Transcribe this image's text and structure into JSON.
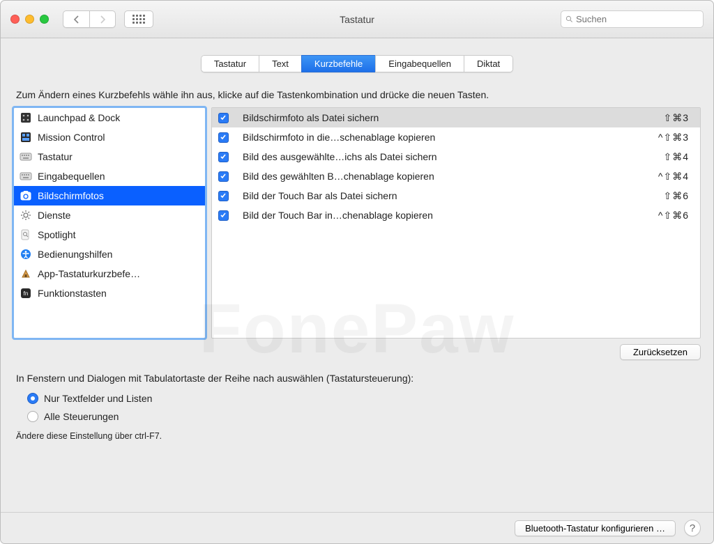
{
  "window": {
    "title": "Tastatur"
  },
  "search": {
    "placeholder": "Suchen"
  },
  "tabs": [
    {
      "label": "Tastatur",
      "active": false
    },
    {
      "label": "Text",
      "active": false
    },
    {
      "label": "Kurzbefehle",
      "active": true
    },
    {
      "label": "Eingabequellen",
      "active": false
    },
    {
      "label": "Diktat",
      "active": false
    }
  ],
  "instruction": "Zum Ändern eines Kurzbefehls wähle ihn aus, klicke auf die Tastenkombination und drücke die neuen Tasten.",
  "categories": [
    {
      "label": "Launchpad & Dock",
      "icon": "launchpad"
    },
    {
      "label": "Mission Control",
      "icon": "mission"
    },
    {
      "label": "Tastatur",
      "icon": "keyboard"
    },
    {
      "label": "Eingabequellen",
      "icon": "keyboard"
    },
    {
      "label": "Bildschirmfotos",
      "icon": "screenshot",
      "selected": true
    },
    {
      "label": "Dienste",
      "icon": "gear"
    },
    {
      "label": "Spotlight",
      "icon": "spotlight"
    },
    {
      "label": "Bedienungshilfen",
      "icon": "accessibility"
    },
    {
      "label": "App-Tastaturkurzbefe…",
      "icon": "app"
    },
    {
      "label": "Funktionstasten",
      "icon": "fn"
    }
  ],
  "shortcuts": [
    {
      "label": "Bildschirmfoto als Datei sichern",
      "keys": "⇧⌘3",
      "checked": true,
      "selected": true
    },
    {
      "label": "Bildschirmfoto in die…schenablage kopieren",
      "keys": "^⇧⌘3",
      "checked": true
    },
    {
      "label": "Bild des ausgewählte…ichs als Datei sichern",
      "keys": "⇧⌘4",
      "checked": true
    },
    {
      "label": "Bild des gewählten B…chenablage kopieren",
      "keys": "^⇧⌘4",
      "checked": true
    },
    {
      "label": "Bild der Touch Bar als Datei sichern",
      "keys": "⇧⌘6",
      "checked": true
    },
    {
      "label": "Bild der Touch Bar in…chenablage kopieren",
      "keys": "^⇧⌘6",
      "checked": true
    }
  ],
  "reset_button": "Zurücksetzen",
  "tabnav": {
    "description": "In Fenstern und Dialogen mit Tabulatortaste der Reihe nach auswählen (Tastatursteuerung):",
    "options": [
      {
        "label": "Nur Textfelder und Listen",
        "selected": true
      },
      {
        "label": "Alle Steuerungen",
        "selected": false
      }
    ],
    "hint": "Ändere diese Einstellung über ctrl-F7."
  },
  "footer": {
    "bluetooth_button": "Bluetooth-Tastatur konfigurieren …"
  },
  "watermark": "FonePaw"
}
